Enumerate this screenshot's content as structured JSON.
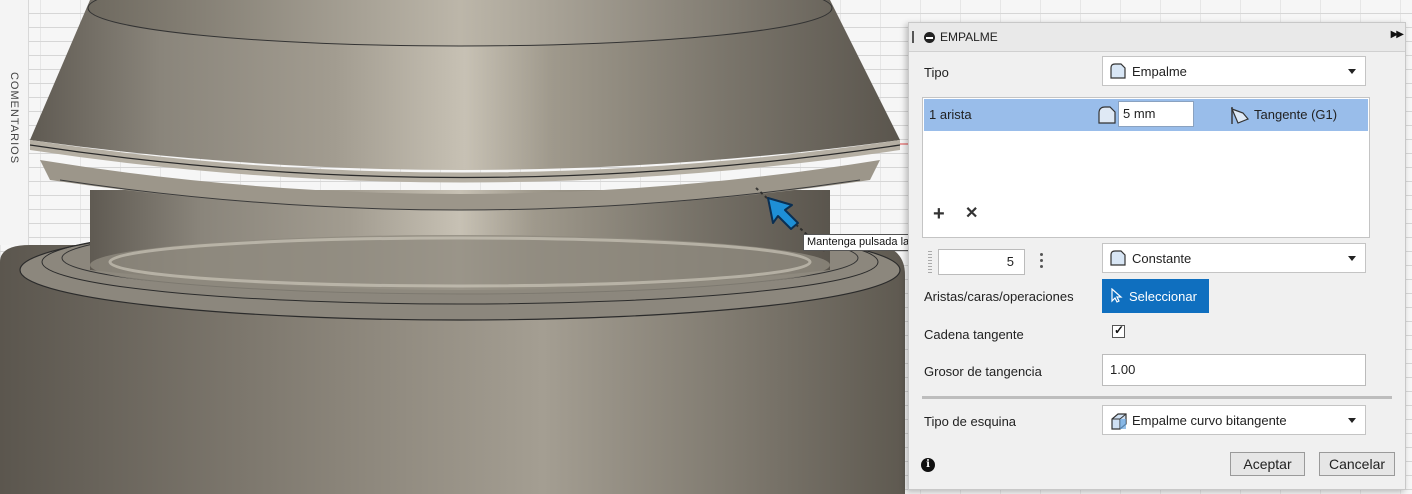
{
  "viewport": {
    "side_tab_label": "COMENTARIOS",
    "tooltip": "Mantenga pulsada la tecla Ctrl para modificar la selección"
  },
  "panel": {
    "title": "EMPALME",
    "type": {
      "label": "Tipo",
      "value": "Empalme"
    },
    "edge_set": {
      "label": "1 arista",
      "radius": "5 mm",
      "continuity": "Tangente (G1)"
    },
    "count_value": "5",
    "radius_type": "Constante",
    "selection": {
      "label": "Aristas/caras/operaciones",
      "button": "Seleccionar"
    },
    "tangent_chain": {
      "label": "Cadena tangente",
      "checked": true
    },
    "tangency_weight": {
      "label": "Grosor de tangencia",
      "value": "1.00"
    },
    "corner_type": {
      "label": "Tipo de esquina",
      "value": "Empalme curvo bitangente"
    },
    "buttons": {
      "ok": "Aceptar",
      "cancel": "Cancelar"
    }
  },
  "colors": {
    "selected_row": "#99bdea",
    "select_button": "#0f6fbf",
    "cursor": "#1e8fd6"
  }
}
